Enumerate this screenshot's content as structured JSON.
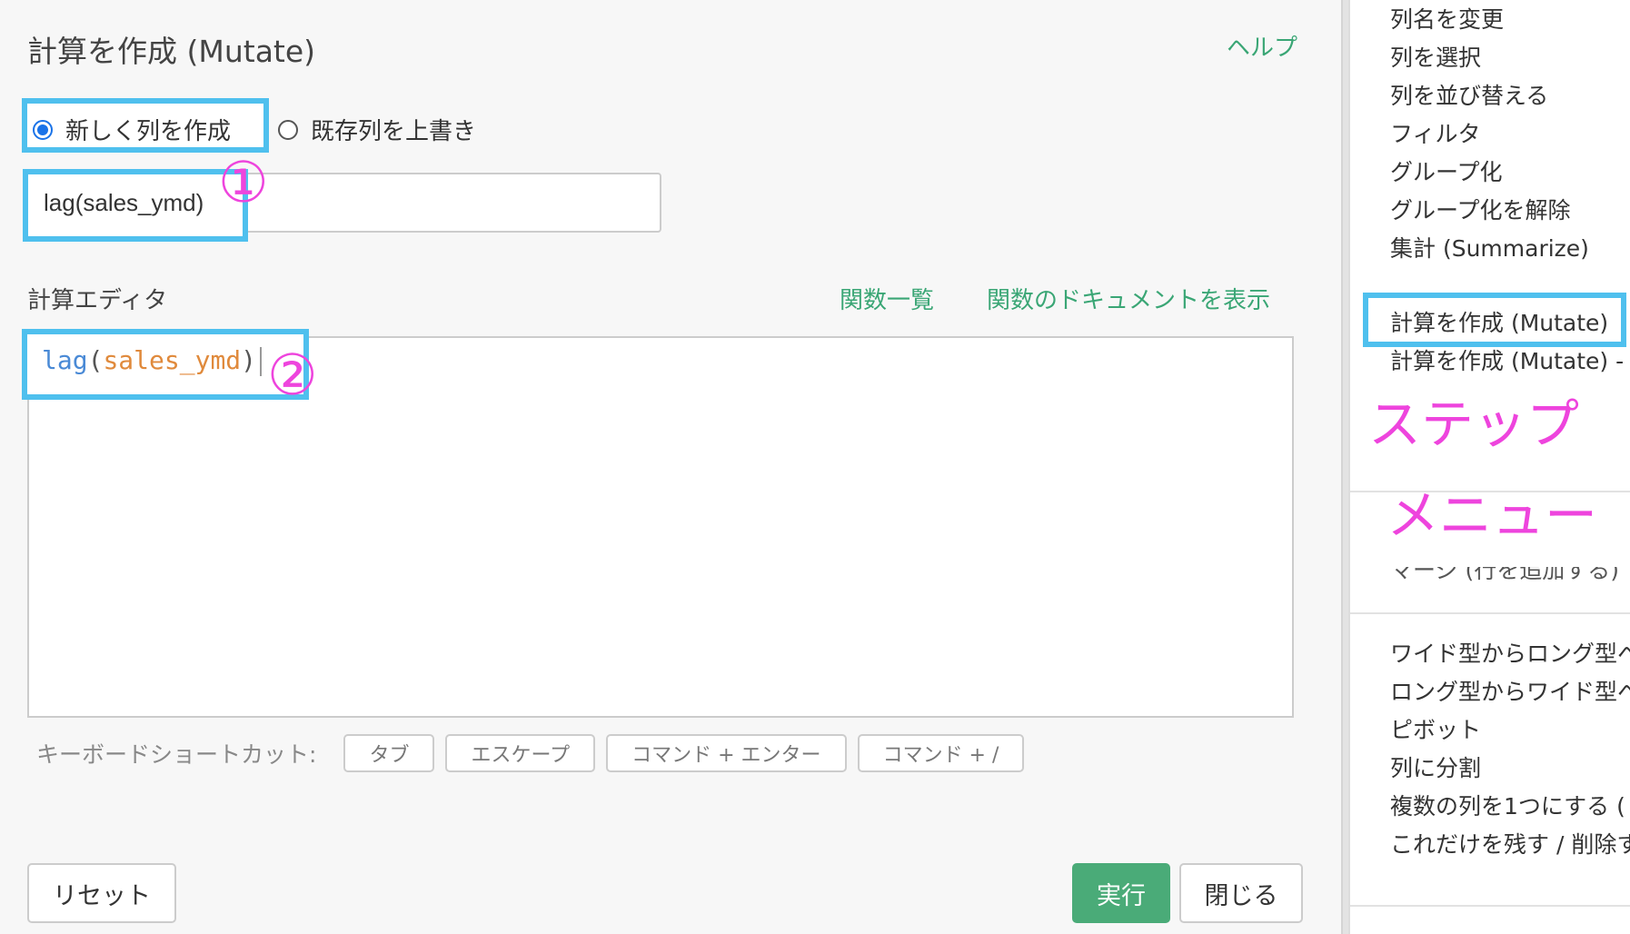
{
  "dialog": {
    "title": "計算を作成 (Mutate)",
    "help_label": "ヘルプ",
    "radio_new_label": "新しく列を作成",
    "radio_overwrite_label": "既存列を上書き",
    "column_name_value": "lag(sales_ymd)",
    "editor_label": "計算エディタ",
    "func_list_label": "関数一覧",
    "func_doc_label": "関数のドキュメントを表示",
    "code": {
      "fn": "lag",
      "open": "(",
      "arg": "sales_ymd",
      "close": ")"
    },
    "shortcut_label": "キーボードショートカット:",
    "shortcuts": [
      "タブ",
      "エスケープ",
      "コマンド + エンター",
      "コマンド + /"
    ],
    "reset_label": "リセット",
    "run_label": "実行",
    "close_label": "閉じる"
  },
  "annotations": {
    "num1": "①",
    "num2": "②",
    "overlay1": "ステップ",
    "overlay2": "メニュー"
  },
  "menu": {
    "items": [
      "列名を変更",
      "列を選択",
      "列を並び替える",
      "フィルタ",
      "グループ化",
      "グループ化を解除",
      "集計 (Summarize)",
      "計算を作成 (Mutate)",
      "計算を作成 (Mutate) - 複"
    ],
    "partial_item": "マージ (行を追加する)",
    "items2": [
      "ワイド型からロング型へ",
      "ロング型からワイド型へ",
      "ピボット",
      "列に分割",
      "複数の列を1つにする (",
      "これだけを残す / 削除す"
    ]
  },
  "colors": {
    "accent_green": "#3aa675",
    "highlight_blue": "#4fc0ee",
    "annotation_pink": "#ee44dd",
    "run_button": "#4aab78"
  }
}
